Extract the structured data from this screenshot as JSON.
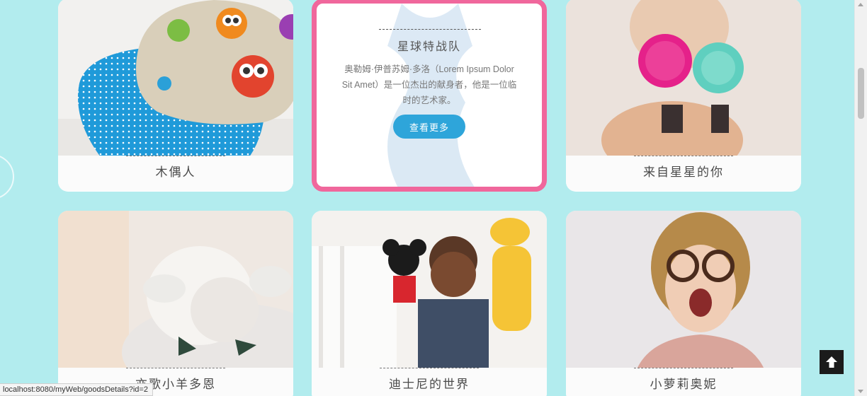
{
  "cards": [
    {
      "title": "木偶人"
    },
    {
      "title": "星球特战队",
      "description": "奥勒姆·伊普苏姆·多洛（Lorem Ipsum Dolor Sit Amet）是一位杰出的献身者，他是一位临时的艺术家。",
      "button": "查看更多"
    },
    {
      "title": "来自星星的你"
    },
    {
      "title": "亦歌小羊多恩"
    },
    {
      "title": "迪士尼的世界"
    },
    {
      "title": "小萝莉奥妮"
    }
  ],
  "status_bar": {
    "url": "localhost:8080/myWeb/goodsDetails?id=2"
  },
  "colors": {
    "background": "#b2ecee",
    "accent_pink": "#f0679c",
    "button_blue": "#2ea5da"
  }
}
